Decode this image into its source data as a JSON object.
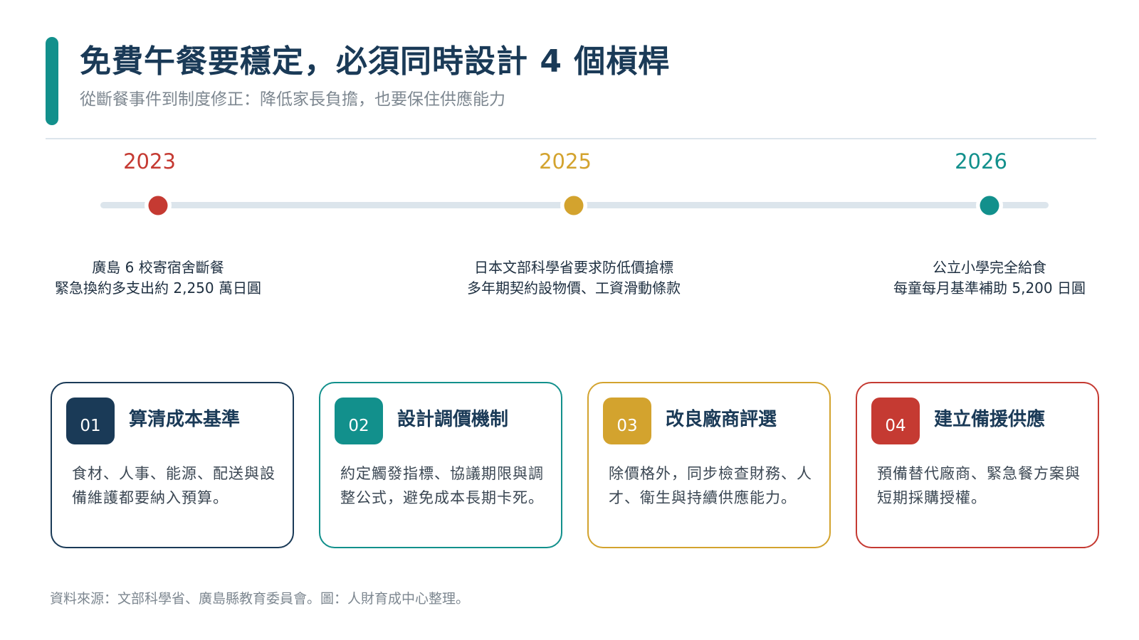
{
  "header": {
    "title": "免費午餐要穩定，必須同時設計 4 個槓桿",
    "subtitle": "從斷餐事件到制度修正：降低家長負擔，也要保住供應能力",
    "accent_color": "#12908c"
  },
  "timeline": {
    "events": [
      {
        "year": "2023",
        "color": "#c53a32",
        "line1": "廣島 6 校寄宿舍斷餐",
        "line2": "緊急換約多支出約 2,250 萬日圓"
      },
      {
        "year": "2025",
        "color": "#d3a32e",
        "line1": "日本文部科學省要求防低價搶標",
        "line2": "多年期契約設物價、工資滑動條款"
      },
      {
        "year": "2026",
        "color": "#12908c",
        "line1": "公立小學完全給食",
        "line2": "每童每月基準補助 5,200 日圓"
      }
    ]
  },
  "cards": [
    {
      "number": "01",
      "color": "#1a3a57",
      "title": "算清成本基準",
      "body": "食材、人事、能源、配送與設備維護都要納入預算。"
    },
    {
      "number": "02",
      "color": "#12908c",
      "title": "設計調價機制",
      "body": "約定觸發指標、協議期限與調整公式，避免成本長期卡死。"
    },
    {
      "number": "03",
      "color": "#d3a32e",
      "title": "改良廠商評選",
      "body": "除價格外，同步檢查財務、人才、衛生與持續供應能力。"
    },
    {
      "number": "04",
      "color": "#c53a32",
      "title": "建立備援供應",
      "body": "預備替代廠商、緊急餐方案與短期採購授權。"
    }
  ],
  "footer": {
    "source": "資料來源：文部科學省、廣島縣教育委員會。圖：人財育成中心整理。"
  }
}
